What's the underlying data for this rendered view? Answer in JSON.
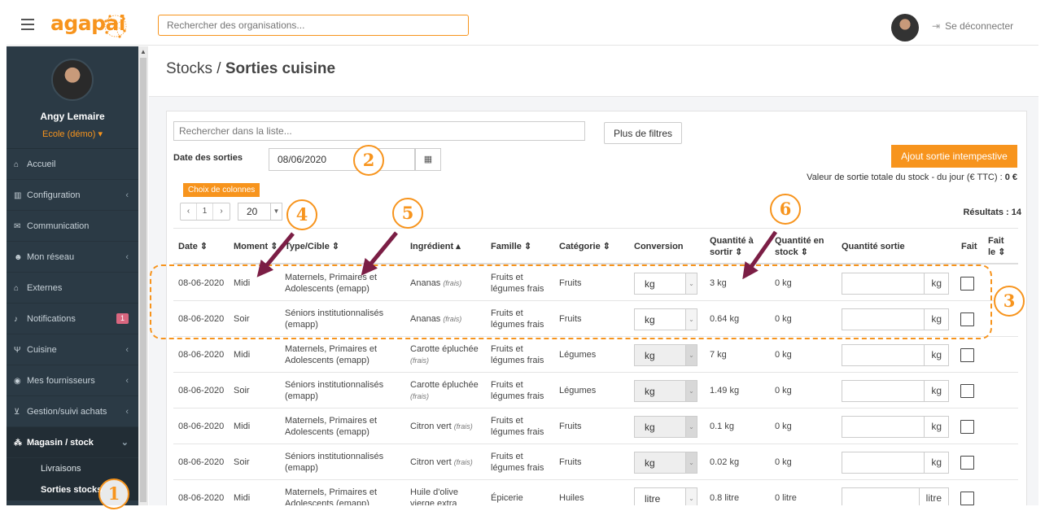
{
  "topbar": {
    "logo": "agapai",
    "search_placeholder": "Rechercher des organisations...",
    "logout_label": "Se déconnecter"
  },
  "sidebar": {
    "user_name": "Angy Lemaire",
    "school": "Ecole (démo) ▾",
    "items": [
      {
        "label": "Accueil",
        "icon": "home-icon",
        "glyph": "⌂",
        "chevron": false
      },
      {
        "label": "Configuration",
        "icon": "bank-icon",
        "glyph": "▥",
        "chevron": true
      },
      {
        "label": "Communication",
        "icon": "chat-icon",
        "glyph": "✉",
        "chevron": false
      },
      {
        "label": "Mon réseau",
        "icon": "users-icon",
        "glyph": "☻",
        "chevron": true
      },
      {
        "label": "Externes",
        "icon": "home-icon",
        "glyph": "⌂",
        "chevron": false
      },
      {
        "label": "Notifications",
        "icon": "bell-icon",
        "glyph": "♪",
        "badge": "1"
      },
      {
        "label": "Cuisine",
        "icon": "cutlery-icon",
        "glyph": "Ψ",
        "chevron": true
      },
      {
        "label": "Mes fournisseurs",
        "icon": "eye-icon",
        "glyph": "◉",
        "chevron": true
      },
      {
        "label": "Gestion/suivi achats",
        "icon": "cart-icon",
        "glyph": "⊻",
        "chevron": true
      },
      {
        "label": "Magasin / stock",
        "icon": "cubes-icon",
        "glyph": "⁂",
        "chevron": true,
        "active": true
      }
    ],
    "subitems": [
      {
        "label": "Livraisons"
      },
      {
        "label": "Sorties stocks"
      }
    ]
  },
  "page": {
    "breadcrumb_parent": "Stocks / ",
    "title": "Sorties cuisine"
  },
  "filters": {
    "list_search_placeholder": "Rechercher dans la liste...",
    "more_filters": "Plus de filtres",
    "date_label": "Date des sorties",
    "date_value": "08/06/2020",
    "add_button": "Ajout sortie intempestive",
    "total_label": "Valeur de sortie totale du stock - du jour (€ TTC) : ",
    "total_value": "0 €",
    "columns_button": "Choix de colonnes",
    "pager_prev": "‹",
    "pager_page": "1",
    "pager_next": "›",
    "page_size": "20",
    "results": "Résultats : 14"
  },
  "table": {
    "headers": {
      "date": "Date ⇕",
      "moment": "Moment ⇕",
      "type": "Type/Cible ⇕",
      "ingredient": "Ingrédient ▴",
      "family": "Famille ⇕",
      "category": "Catégorie ⇕",
      "conversion": "Conversion",
      "qty_out_1": "Quantité à",
      "qty_out_2": "sortir ⇕",
      "qty_stock_1": "Quantité en",
      "qty_stock_2": "stock ⇕",
      "qty_exit": "Quantité sortie",
      "done": "Fait",
      "done_on_1": "Fait",
      "done_on_2": "le ⇕"
    },
    "rows": [
      {
        "date": "08-06-2020",
        "moment": "Midi",
        "type1": "Maternels, Primaires et",
        "type2": "Adolescents (emapp)",
        "ingredient": "Ananas",
        "ing_note": "(frais)",
        "ing2": "",
        "family1": "Fruits et",
        "family2": "légumes frais",
        "category": "Fruits",
        "conversion": "kg",
        "conv_disabled": false,
        "qty_out": "3 kg",
        "qty_stock": "0 kg",
        "unit": "kg"
      },
      {
        "date": "08-06-2020",
        "moment": "Soir",
        "type1": "Séniors institutionnalisés",
        "type2": "(emapp)",
        "ingredient": "Ananas",
        "ing_note": "(frais)",
        "ing2": "",
        "family1": "Fruits et",
        "family2": "légumes frais",
        "category": "Fruits",
        "conversion": "kg",
        "conv_disabled": false,
        "qty_out": "0.64 kg",
        "qty_stock": "0 kg",
        "unit": "kg"
      },
      {
        "date": "08-06-2020",
        "moment": "Midi",
        "type1": "Maternels, Primaires et",
        "type2": "Adolescents (emapp)",
        "ingredient": "Carotte épluchée",
        "ing_note": "",
        "ing2": "(frais)",
        "family1": "Fruits et",
        "family2": "légumes frais",
        "category": "Légumes",
        "conversion": "kg",
        "conv_disabled": true,
        "qty_out": "7 kg",
        "qty_stock": "0 kg",
        "unit": "kg"
      },
      {
        "date": "08-06-2020",
        "moment": "Soir",
        "type1": "Séniors institutionnalisés",
        "type2": "(emapp)",
        "ingredient": "Carotte épluchée",
        "ing_note": "",
        "ing2": "(frais)",
        "family1": "Fruits et",
        "family2": "légumes frais",
        "category": "Légumes",
        "conversion": "kg",
        "conv_disabled": true,
        "qty_out": "1.49 kg",
        "qty_stock": "0 kg",
        "unit": "kg"
      },
      {
        "date": "08-06-2020",
        "moment": "Midi",
        "type1": "Maternels, Primaires et",
        "type2": "Adolescents (emapp)",
        "ingredient": "Citron vert",
        "ing_note": "(frais)",
        "ing2": "",
        "family1": "Fruits et",
        "family2": "légumes frais",
        "category": "Fruits",
        "conversion": "kg",
        "conv_disabled": true,
        "qty_out": "0.1 kg",
        "qty_stock": "0 kg",
        "unit": "kg"
      },
      {
        "date": "08-06-2020",
        "moment": "Soir",
        "type1": "Séniors institutionnalisés",
        "type2": "(emapp)",
        "ingredient": "Citron vert",
        "ing_note": "(frais)",
        "ing2": "",
        "family1": "Fruits et",
        "family2": "légumes frais",
        "category": "Fruits",
        "conversion": "kg",
        "conv_disabled": true,
        "qty_out": "0.02 kg",
        "qty_stock": "0 kg",
        "unit": "kg"
      },
      {
        "date": "08-06-2020",
        "moment": "Midi",
        "type1": "Maternels, Primaires et",
        "type2": "Adolescents (emapp)",
        "ingredient": "Huile d'olive",
        "ing_note": "",
        "ing2": "vierge extra",
        "family1": "Épicerie",
        "family2": "",
        "category": "Huiles",
        "conversion": "litre",
        "conv_disabled": false,
        "qty_out": "0.8 litre",
        "qty_stock": "0 litre",
        "unit": "litre"
      }
    ]
  },
  "annotations": [
    "1",
    "2",
    "3",
    "4",
    "5",
    "6"
  ],
  "colors": {
    "accent": "#f7941d",
    "sidebar": "#2b3a45",
    "arrow": "#7b1e45"
  }
}
